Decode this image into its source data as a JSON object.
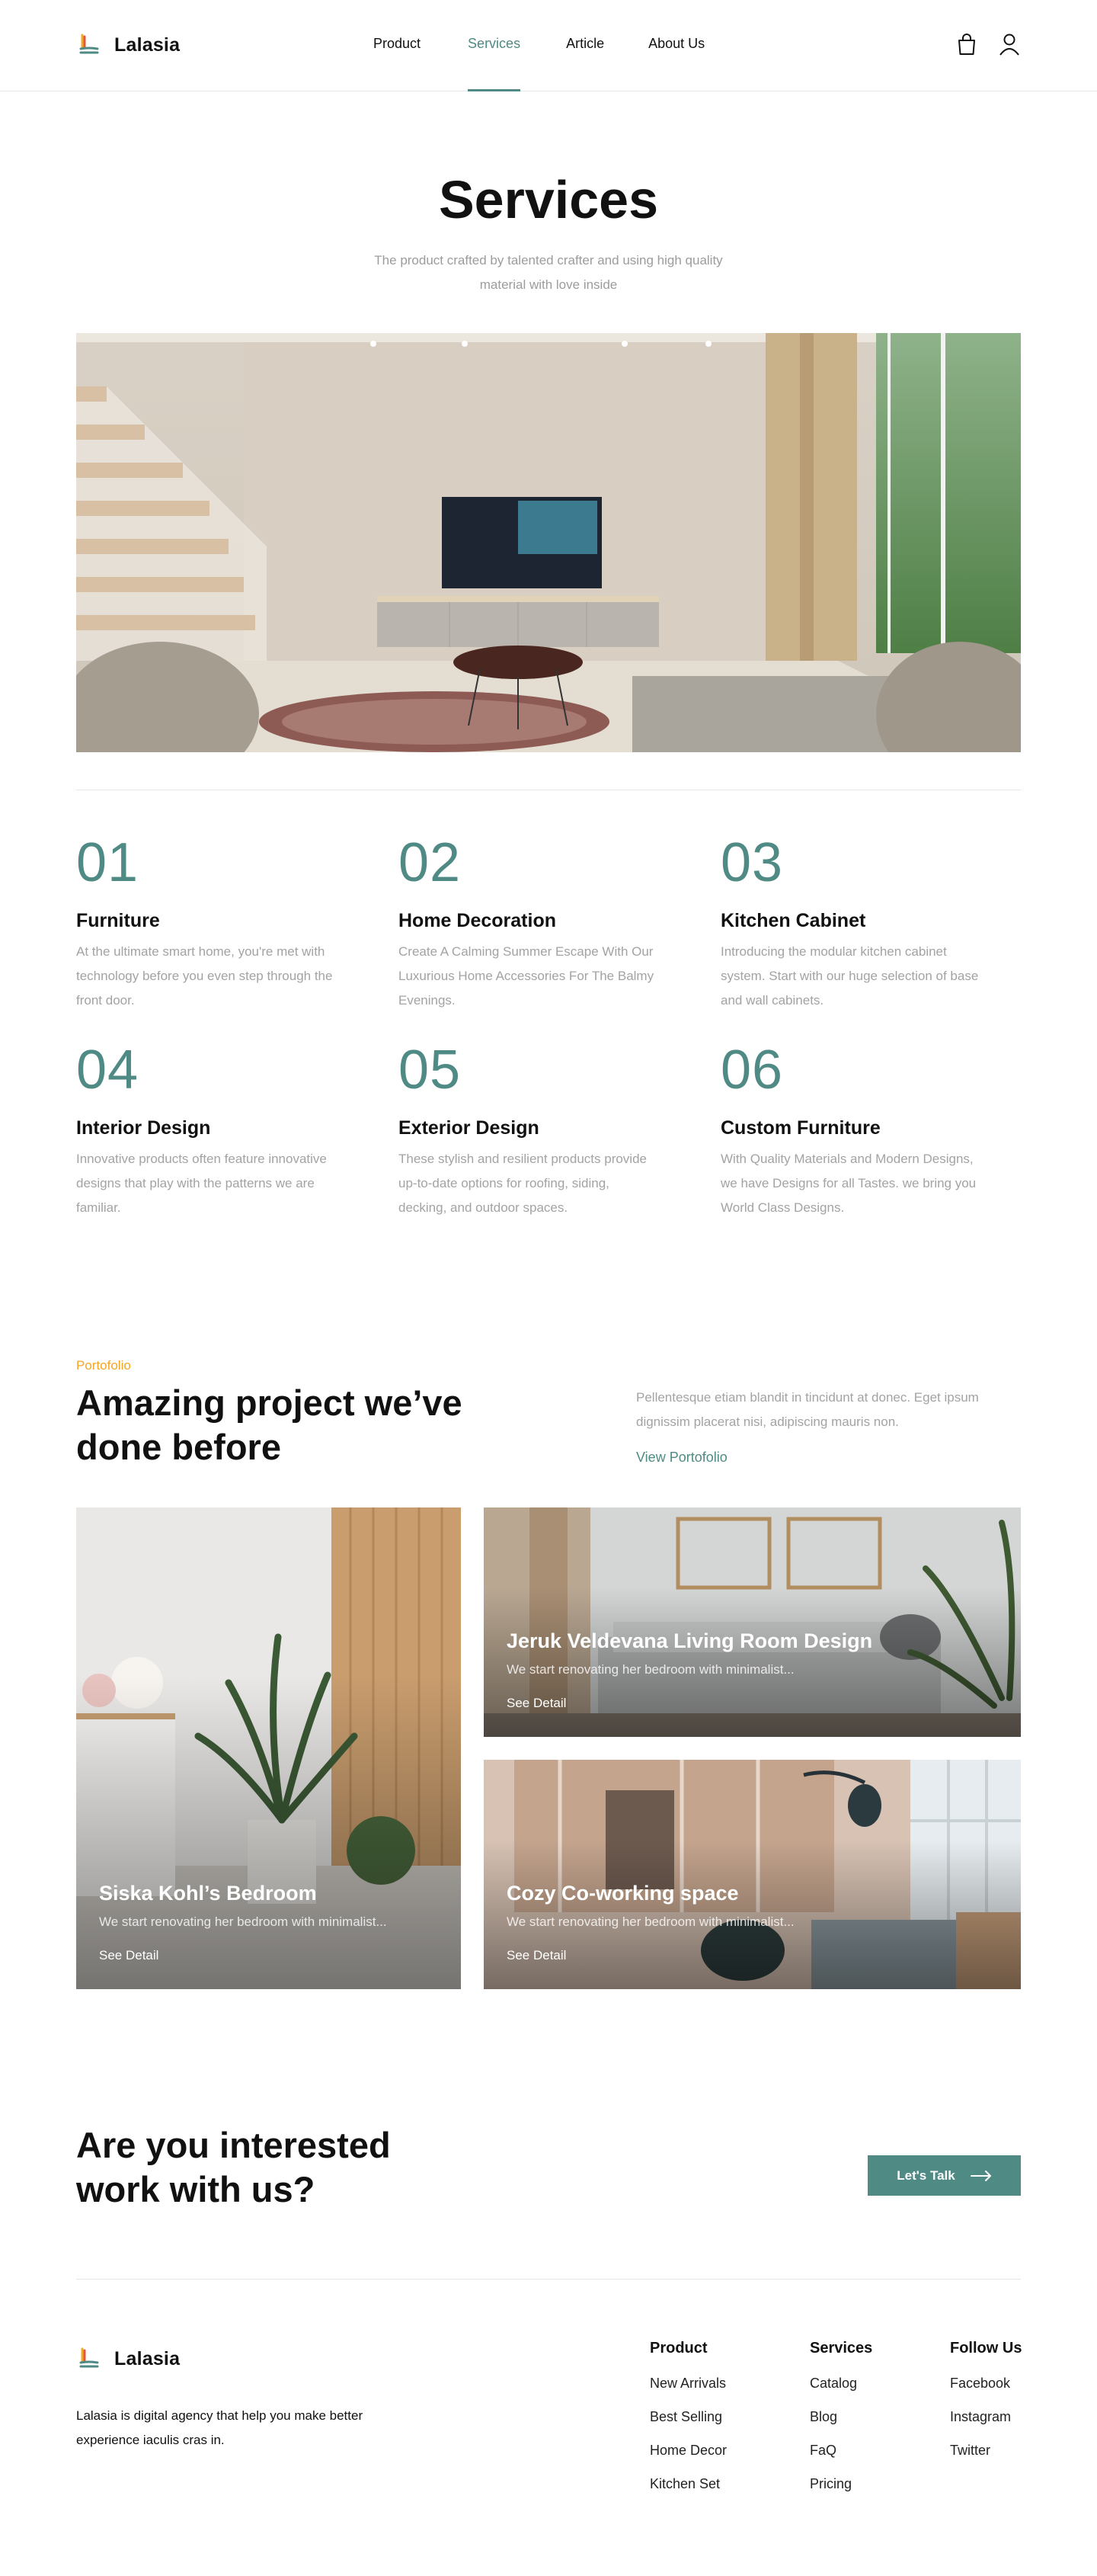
{
  "brand": {
    "name": "Lalasia"
  },
  "nav": {
    "items": [
      {
        "label": "Product"
      },
      {
        "label": "Services"
      },
      {
        "label": "Article"
      },
      {
        "label": "About Us"
      }
    ],
    "active_index": 1,
    "icons": [
      "shopping-bag-icon",
      "user-icon"
    ]
  },
  "hero": {
    "title": "Services",
    "subtitle": "The product crafted by talented crafter and using high quality material with love inside"
  },
  "services": [
    {
      "num": "01",
      "title": "Furniture",
      "desc": "At the ultimate smart home, you're met with technology before you even step through the front door."
    },
    {
      "num": "02",
      "title": "Home Decoration",
      "desc": "Create A Calming Summer Escape With Our Luxurious Home Accessories For The Balmy Evenings."
    },
    {
      "num": "03",
      "title": "Kitchen Cabinet",
      "desc": "Introducing the modular kitchen cabinet system. Start with our huge selection of base and wall cabinets."
    },
    {
      "num": "04",
      "title": "Interior Design",
      "desc": "Innovative products often feature innovative designs that play with the patterns we are familiar."
    },
    {
      "num": "05",
      "title": "Exterior Design",
      "desc": "These stylish and resilient products provide up-to-date options for roofing, siding, decking, and outdoor spaces."
    },
    {
      "num": "06",
      "title": "Custom Furniture",
      "desc": "With Quality Materials and Modern Designs, we have Designs for all Tastes. we bring you World Class Designs."
    }
  ],
  "portfolio": {
    "eyebrow": "Portofolio",
    "title": "Amazing project we’ve done before",
    "desc": "Pellentesque etiam blandit in tincidunt at donec. Eget ipsum dignissim placerat nisi, adipiscing mauris non.",
    "link": "View Portofolio",
    "cards": [
      {
        "title": "Siska Kohl’s Bedroom",
        "desc": "We start renovating her bedroom with minimalist...",
        "link": "See Detail"
      },
      {
        "title": "Jeruk Veldevana Living Room Design",
        "desc": "We start renovating her bedroom with minimalist...",
        "link": "See Detail"
      },
      {
        "title": "Cozy Co-working space",
        "desc": "We start renovating her bedroom with minimalist...",
        "link": "See Detail"
      }
    ]
  },
  "cta": {
    "title": "Are you interested work with us?",
    "button": "Let's Talk"
  },
  "footer": {
    "about": "Lalasia is digital agency that help you make better experience iaculis cras in.",
    "columns": [
      {
        "title": "Product",
        "links": [
          "New Arrivals",
          "Best Selling",
          "Home Decor",
          "Kitchen Set"
        ]
      },
      {
        "title": "Services",
        "links": [
          "Catalog",
          "Blog",
          "FaQ",
          "Pricing"
        ]
      },
      {
        "title": "Follow Us",
        "links": [
          "Facebook",
          "Instagram",
          "Twitter"
        ]
      }
    ]
  },
  "colors": {
    "accent": "#4f8a84",
    "eyebrow": "#f5a623",
    "muted": "#a3a3a3"
  }
}
